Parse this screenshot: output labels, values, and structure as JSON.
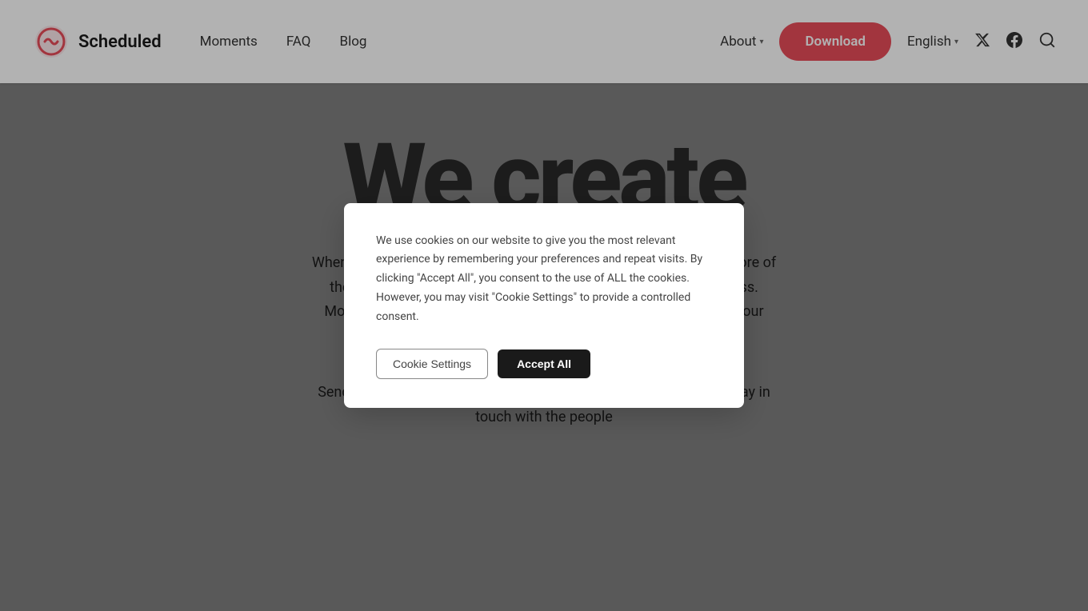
{
  "navbar": {
    "logo_text": "Scheduled",
    "links": [
      {
        "id": "moments",
        "label": "Moments"
      },
      {
        "id": "faq",
        "label": "FAQ"
      },
      {
        "id": "blog",
        "label": "Blog"
      }
    ],
    "about_label": "About",
    "download_label": "Download",
    "english_label": "English",
    "twitter_icon": "𝕏",
    "facebook_icon": "f",
    "search_icon": "🔍"
  },
  "hero": {
    "title": "We create",
    "subtitle": "When people are together, sparks are created. We want to create more of these moments. That's why we're in the moment-creating business. Moments that we organize and moments that you create through our products.",
    "send_text": "Send scheduled messages with your favourite message apps or stay in touch with the people"
  },
  "cookie_modal": {
    "body_text": "We use cookies on our website to give you the most relevant experience by remembering your preferences and repeat visits. By clicking \"Accept All\", you consent to the use of ALL the cookies. However, you may visit \"Cookie Settings\" to provide a controlled consent.",
    "settings_label": "Cookie Settings",
    "accept_label": "Accept All"
  }
}
